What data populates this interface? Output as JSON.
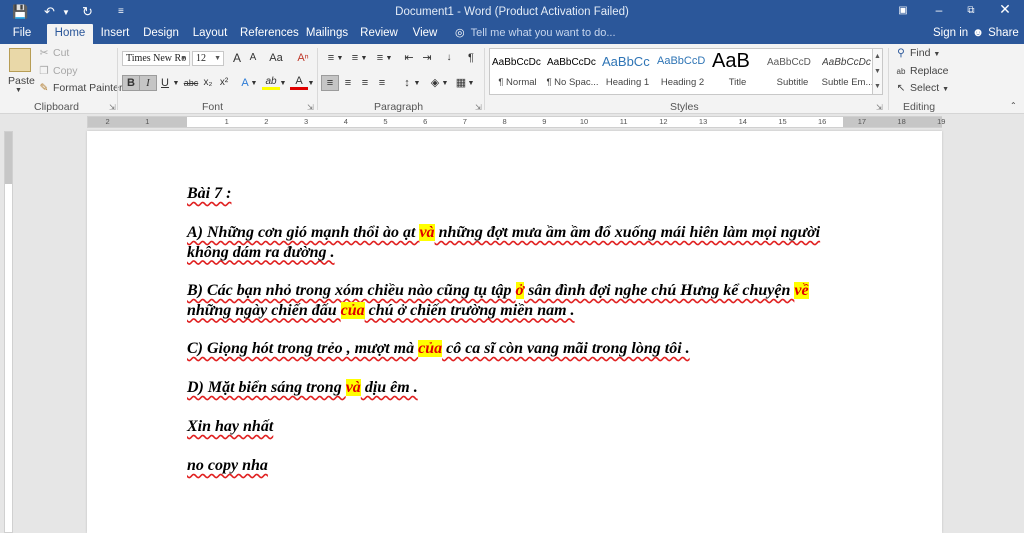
{
  "window": {
    "title": "Document1 - Word (Product Activation Failed)"
  },
  "tabs": [
    {
      "label": "File"
    },
    {
      "label": "Home"
    },
    {
      "label": "Insert"
    },
    {
      "label": "Design"
    },
    {
      "label": "Layout"
    },
    {
      "label": "References"
    },
    {
      "label": "Mailings"
    },
    {
      "label": "Review"
    },
    {
      "label": "View"
    }
  ],
  "tell_me": {
    "placeholder": "Tell me what you want to do..."
  },
  "account": {
    "signin": "Sign in",
    "share": "Share"
  },
  "clipboard": {
    "paste": "Paste",
    "cut": "Cut",
    "copy": "Copy",
    "format_painter": "Format Painter",
    "group": "Clipboard"
  },
  "font": {
    "name": "Times New Ro",
    "size": "12",
    "group": "Font",
    "bold": "B",
    "italic": "I",
    "underline": "U",
    "strike": "abc",
    "subscript": "x₂",
    "superscript": "x²",
    "grow": "A",
    "shrink": "A",
    "change_case": "Aa",
    "font_color": "A",
    "highlight": "ab",
    "text_effects": "A"
  },
  "paragraph": {
    "group": "Paragraph"
  },
  "styles": {
    "group": "Styles",
    "items": [
      {
        "preview": "AaBbCcDc",
        "name": "¶ Normal"
      },
      {
        "preview": "AaBbCcDc",
        "name": "¶ No Spac..."
      },
      {
        "preview": "AaBbCc",
        "name": "Heading 1"
      },
      {
        "preview": "AaBbCcD",
        "name": "Heading 2"
      },
      {
        "preview": "AaB",
        "name": "Title"
      },
      {
        "preview": "AaBbCcD",
        "name": "Subtitle"
      },
      {
        "preview": "AaBbCcDc",
        "name": "Subtle Em..."
      }
    ]
  },
  "editing": {
    "group": "Editing",
    "find": "Find",
    "replace": "Replace",
    "select": "Select"
  },
  "ruler": {
    "ticks": [
      "2",
      "1",
      "1",
      "2",
      "3",
      "4",
      "5",
      "6",
      "7",
      "8",
      "9",
      "10",
      "11",
      "12",
      "13",
      "14",
      "15",
      "16",
      "17",
      "18",
      "19"
    ]
  },
  "document": {
    "title": "Bài 7 :",
    "a_1": "A) Những cơn gió mạnh thổi ào ạt ",
    "a_hl": "và",
    "a_2": " những đợt mưa ầm ầm đổ xuống mái hiên làm mọi người không dám ra đường .",
    "b_1": "B) Các bạn nhỏ trong xóm chiều nào cũng tụ tập ",
    "b_hl1": "ở",
    "b_2": " sân đình đợi nghe chú Hưng kể chuyện ",
    "b_hl2": "về",
    "b_3": " những ngày chiến đấu ",
    "b_hl3": "của",
    "b_4": " chú ở chiến trường miền nam .",
    "c_1": "C) Giọng hót trong trẻo , mượt mà ",
    "c_hl": "của",
    "c_2": " cô ca sĩ còn vang mãi trong lòng tôi .",
    "d_1": "D) Mặt biển sáng trong ",
    "d_hl": "và",
    "d_2": " dịu êm .",
    "line_e": "Xin hay nhất",
    "line_f": "no copy nha"
  }
}
